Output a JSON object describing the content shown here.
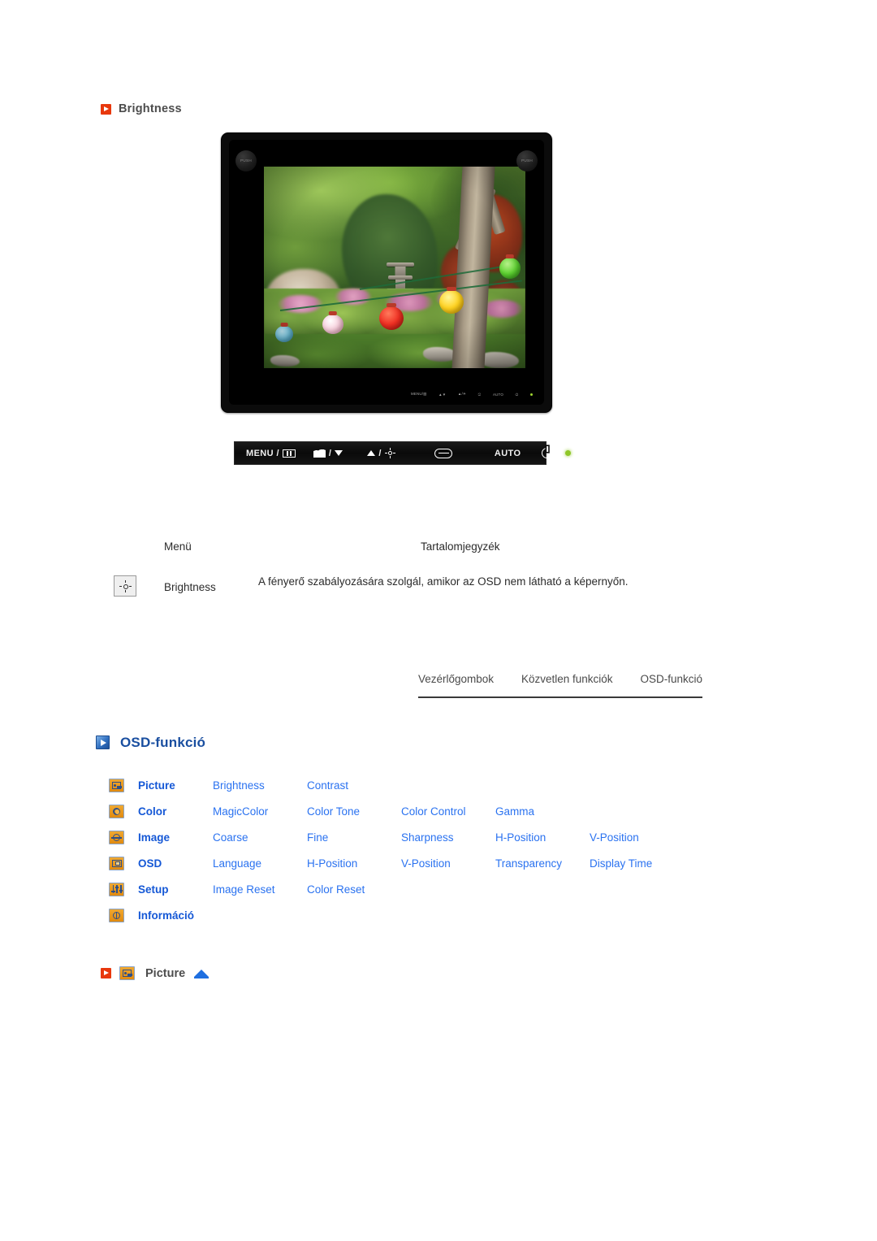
{
  "page": {
    "section_title": "Brightness",
    "heading_osd": "OSD-funkció",
    "bottom_label": "Picture"
  },
  "monitor": {
    "push_left": "PUSH",
    "push_right": "PUSH",
    "bezel_labels": [
      "MENU",
      "MAGIC",
      "BRIGHT",
      "ENTER",
      "AUTO",
      "POWER"
    ]
  },
  "control_bar": {
    "menu_label": "MENU /",
    "magic_label": "/",
    "up_label": "/",
    "auto_label": "AUTO",
    "icons": {
      "menu": "menu-grid-icon",
      "magic": "magicbright-icon",
      "down": "triangle-down-icon",
      "up": "triangle-up-icon",
      "brightness": "sun-icon",
      "enter": "enter-key-icon",
      "power": "power-icon",
      "led": "power-led-icon"
    }
  },
  "description_table": {
    "col_menu": "Menü",
    "col_contents": "Tartalomjegyzék",
    "rows": [
      {
        "icon": "brightness-sun-icon",
        "name": "Brightness",
        "description": "A fényerő szabályozására szolgál, amikor az OSD nem látható a képernyőn."
      }
    ]
  },
  "tabs": [
    {
      "label": "Vezérlőgombok"
    },
    {
      "label": "Közvetlen funkciók"
    },
    {
      "label": "OSD-funkció"
    }
  ],
  "osd_menu": {
    "rows": [
      {
        "icon": "picture-icon",
        "category": "Picture",
        "items": [
          "Brightness",
          "Contrast"
        ]
      },
      {
        "icon": "color-icon",
        "category": "Color",
        "items": [
          "MagicColor",
          "Color Tone",
          "Color Control",
          "Gamma"
        ]
      },
      {
        "icon": "image-icon",
        "category": "Image",
        "items": [
          "Coarse",
          "Fine",
          "Sharpness",
          "H-Position",
          "V-Position"
        ]
      },
      {
        "icon": "osd-icon",
        "category": "OSD",
        "items": [
          "Language",
          "H-Position",
          "V-Position",
          "Transparency",
          "Display Time"
        ]
      },
      {
        "icon": "setup-icon",
        "category": "Setup",
        "items": [
          "Image Reset",
          "Color Reset"
        ]
      },
      {
        "icon": "information-icon",
        "category": "Információ",
        "items": []
      }
    ]
  },
  "colors": {
    "link_blue": "#2a72f0",
    "category_blue": "#1558d6",
    "heading_blue": "#1a4fa0",
    "bullet_red": "#e8380d",
    "icon_orange": "#e8941a",
    "text_gray": "#4d4d4d"
  }
}
